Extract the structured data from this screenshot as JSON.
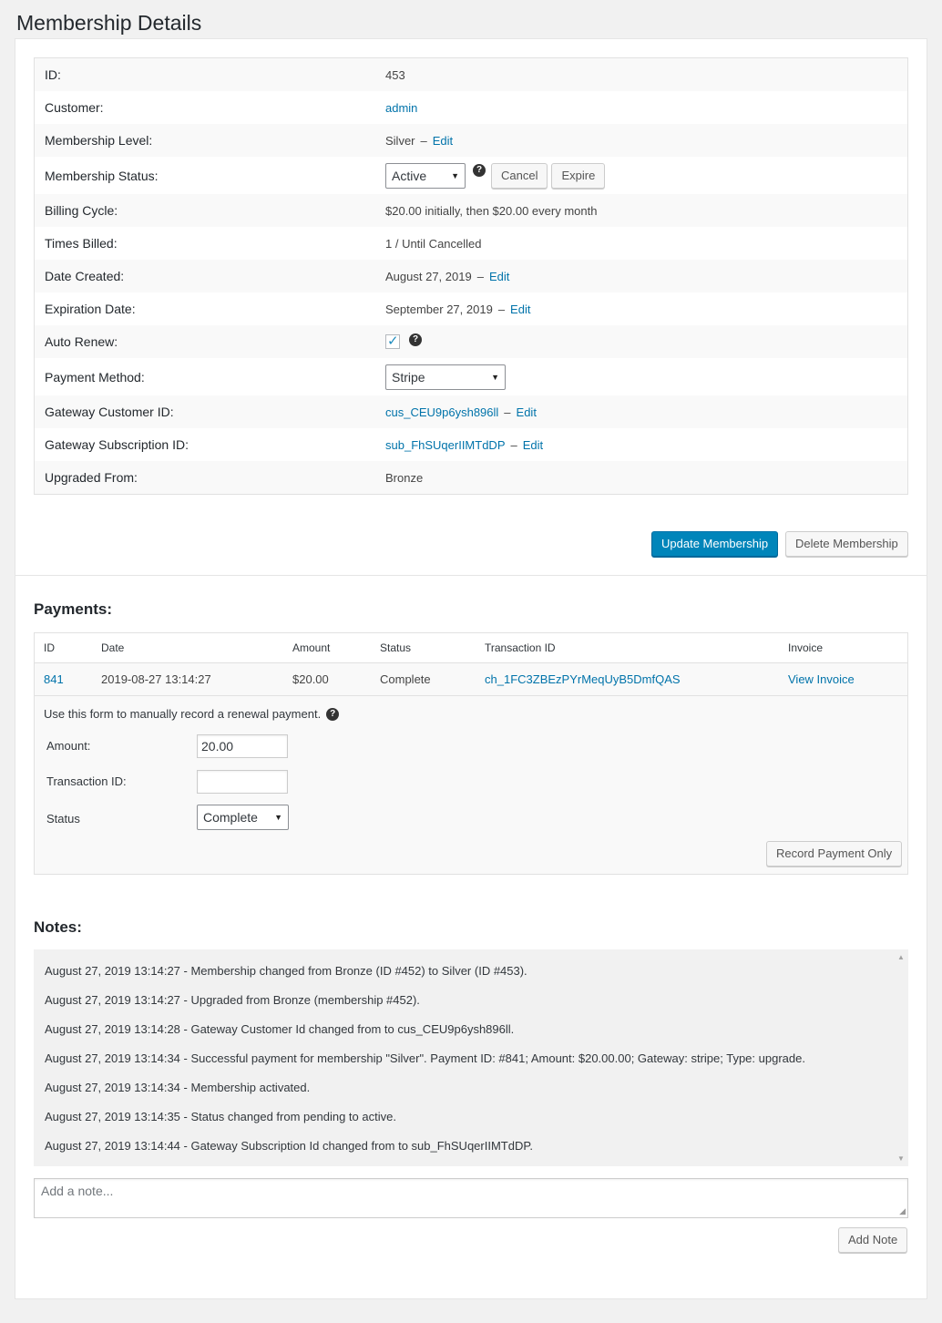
{
  "page": {
    "title": "Membership Details"
  },
  "details": {
    "id": {
      "label": "ID:",
      "value": "453"
    },
    "customer": {
      "label": "Customer:",
      "value": "admin"
    },
    "level": {
      "label": "Membership Level:",
      "value": "Silver",
      "dash": "–",
      "edit": "Edit"
    },
    "status": {
      "label": "Membership Status:",
      "selected": "Active",
      "help": "?",
      "cancel": "Cancel",
      "expire": "Expire"
    },
    "billing": {
      "label": "Billing Cycle:",
      "value": "$20.00 initially, then $20.00 every month"
    },
    "times_billed": {
      "label": "Times Billed:",
      "value": "1 / Until Cancelled"
    },
    "created": {
      "label": "Date Created:",
      "value": "August 27, 2019",
      "dash": "–",
      "edit": "Edit"
    },
    "expiration": {
      "label": "Expiration Date:",
      "value": "September 27, 2019",
      "dash": "–",
      "edit": "Edit"
    },
    "auto_renew": {
      "label": "Auto Renew:",
      "checked": true,
      "help": "?"
    },
    "payment_method": {
      "label": "Payment Method:",
      "selected": "Stripe"
    },
    "gateway_customer": {
      "label": "Gateway Customer ID:",
      "value": "cus_CEU9p6ysh896ll",
      "dash": "–",
      "edit": "Edit"
    },
    "gateway_subscription": {
      "label": "Gateway Subscription ID:",
      "value": "sub_FhSUqerIIMTdDP",
      "dash": "–",
      "edit": "Edit"
    },
    "upgraded_from": {
      "label": "Upgraded From:",
      "value": "Bronze"
    }
  },
  "actions": {
    "update": "Update Membership",
    "delete": "Delete Membership"
  },
  "payments": {
    "title": "Payments:",
    "columns": [
      "ID",
      "Date",
      "Amount",
      "Status",
      "Transaction ID",
      "Invoice"
    ],
    "rows": [
      {
        "id": "841",
        "date": "2019-08-27 13:14:27",
        "amount": "$20.00",
        "status": "Complete",
        "transaction_id": "ch_1FC3ZBEzPYrMeqUyB5DmfQAS",
        "invoice": "View Invoice"
      }
    ],
    "form": {
      "intro": "Use this form to manually record a renewal payment.",
      "help": "?",
      "amount_label": "Amount:",
      "amount_value": "20.00",
      "transaction_label": "Transaction ID:",
      "transaction_value": "",
      "status_label": "Status",
      "status_selected": "Complete",
      "record_button": "Record Payment Only"
    }
  },
  "notes": {
    "title": "Notes:",
    "items": [
      "August 27, 2019 13:14:27 - Membership changed from Bronze (ID #452) to Silver (ID #453).",
      "August 27, 2019 13:14:27 - Upgraded from Bronze (membership #452).",
      "August 27, 2019 13:14:28 - Gateway Customer Id changed from to cus_CEU9p6ysh896ll.",
      "August 27, 2019 13:14:34 - Successful payment for membership \"Silver\". Payment ID: #841; Amount: $20.00.00; Gateway: stripe; Type: upgrade.",
      "August 27, 2019 13:14:34 - Membership activated.",
      "August 27, 2019 13:14:35 - Status changed from pending to active.",
      "August 27, 2019 13:14:44 - Gateway Subscription Id changed from to sub_FhSUqerIIMTdDP."
    ],
    "placeholder": "Add a note...",
    "add_button": "Add Note"
  }
}
